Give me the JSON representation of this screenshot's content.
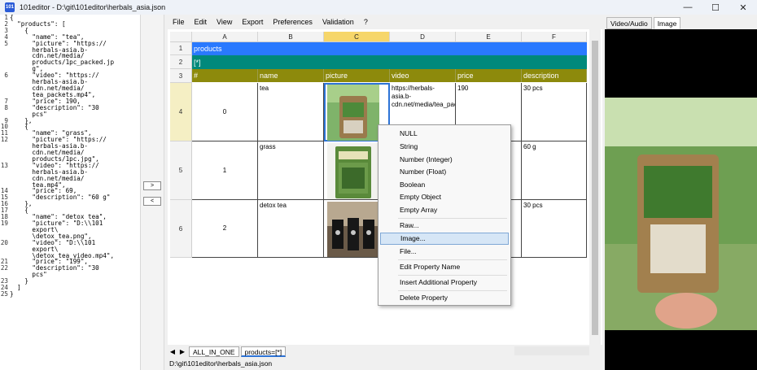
{
  "window": {
    "title": "101editor - D:\\git\\101editor\\herbals_asia.json",
    "app_icon_text": "101",
    "minimize": "—",
    "maximize": "☐",
    "close": "✕"
  },
  "json_lines": [
    {
      "n": "1",
      "t": "{"
    },
    {
      "n": "2",
      "t": "  \"products\": ["
    },
    {
      "n": "3",
      "t": "    {"
    },
    {
      "n": "4",
      "t": "      \"name\": \"tea\","
    },
    {
      "n": "5",
      "t": "      \"picture\": \"https://"
    },
    {
      "n": "",
      "t": "      herbals-asia.b-"
    },
    {
      "n": "",
      "t": "      cdn.net/media/"
    },
    {
      "n": "",
      "t": "      products/1pc_packed.jp"
    },
    {
      "n": "",
      "t": "      g\","
    },
    {
      "n": "6",
      "t": "      \"video\": \"https://"
    },
    {
      "n": "",
      "t": "      herbals-asia.b-"
    },
    {
      "n": "",
      "t": "      cdn.net/media/"
    },
    {
      "n": "",
      "t": "      tea_packets.mp4\","
    },
    {
      "n": "7",
      "t": "      \"price\": 190,"
    },
    {
      "n": "8",
      "t": "      \"description\": \"30"
    },
    {
      "n": "",
      "t": "      pcs\""
    },
    {
      "n": "9",
      "t": "    },"
    },
    {
      "n": "10",
      "t": "    {"
    },
    {
      "n": "11",
      "t": "      \"name\": \"grass\","
    },
    {
      "n": "12",
      "t": "      \"picture\": \"https://"
    },
    {
      "n": "",
      "t": "      herbals-asia.b-"
    },
    {
      "n": "",
      "t": "      cdn.net/media/"
    },
    {
      "n": "",
      "t": "      products/1pc.jpg\","
    },
    {
      "n": "13",
      "t": "      \"video\": \"https://"
    },
    {
      "n": "",
      "t": "      herbals-asia.b-"
    },
    {
      "n": "",
      "t": "      cdn.net/media/"
    },
    {
      "n": "",
      "t": "      tea.mp4\","
    },
    {
      "n": "14",
      "t": "      \"price\": 69,"
    },
    {
      "n": "15",
      "t": "      \"description\": \"60 g\""
    },
    {
      "n": "16",
      "t": "    },"
    },
    {
      "n": "17",
      "t": "    {"
    },
    {
      "n": "18",
      "t": "      \"name\": \"detox tea\","
    },
    {
      "n": "19",
      "t": "      \"picture\": \"D:\\\\101"
    },
    {
      "n": "",
      "t": "      export\\"
    },
    {
      "n": "",
      "t": "      \\detox_tea.png\","
    },
    {
      "n": "20",
      "t": "      \"video\": \"D:\\\\101"
    },
    {
      "n": "",
      "t": "      export\\"
    },
    {
      "n": "",
      "t": "      \\detox_tea_video.mp4\","
    },
    {
      "n": "21",
      "t": "      \"price\": \"199\","
    },
    {
      "n": "22",
      "t": "      \"description\": \"30"
    },
    {
      "n": "",
      "t": "      pcs\""
    },
    {
      "n": "23",
      "t": "    }"
    },
    {
      "n": "24",
      "t": "  ]"
    },
    {
      "n": "25",
      "t": "}"
    }
  ],
  "gutter": {
    "push_right": ">",
    "push_left": "<"
  },
  "menu": [
    "File",
    "Edit",
    "View",
    "Export",
    "Preferences",
    "Validation",
    "?"
  ],
  "columns": [
    "A",
    "B",
    "C",
    "D",
    "E",
    "F"
  ],
  "rows": [
    "1",
    "2",
    "3",
    "4",
    "5",
    "6"
  ],
  "band_products": "products",
  "band_array": "[*]",
  "headers": [
    "#",
    "name",
    "picture",
    "video",
    "price",
    "description"
  ],
  "records": [
    {
      "idx": "0",
      "name": "tea",
      "video": "https://herbals-asia.b-cdn.net/media/tea_packets.mp4",
      "price": "190",
      "description": "30 pcs"
    },
    {
      "idx": "1",
      "name": "grass",
      "video": "",
      "price": "",
      "description": "60 g"
    },
    {
      "idx": "2",
      "name": "detox tea",
      "video": "",
      "price": "",
      "description": "30 pcs"
    }
  ],
  "context_menu": {
    "null": "NULL",
    "string": "String",
    "int": "Number (Integer)",
    "float": "Number (Float)",
    "bool": "Boolean",
    "empty_obj": "Empty Object",
    "empty_arr": "Empty Array",
    "raw": "Raw...",
    "image": "Image...",
    "file": "File...",
    "edit_name": "Edit Property Name",
    "insert": "Insert Additional Property",
    "delete": "Delete Property"
  },
  "sheet_tabs": [
    "ALL_IN_ONE",
    "products=[*]"
  ],
  "status_path": "D:\\git\\101editor\\herbals_asia.json",
  "side_tabs": [
    "Video/Audio",
    "Image"
  ],
  "colors": {
    "band_blue": "#2979ff",
    "band_teal": "#00897b",
    "header_olive": "#8d8a0c",
    "selected_col": "#f6d66a"
  }
}
